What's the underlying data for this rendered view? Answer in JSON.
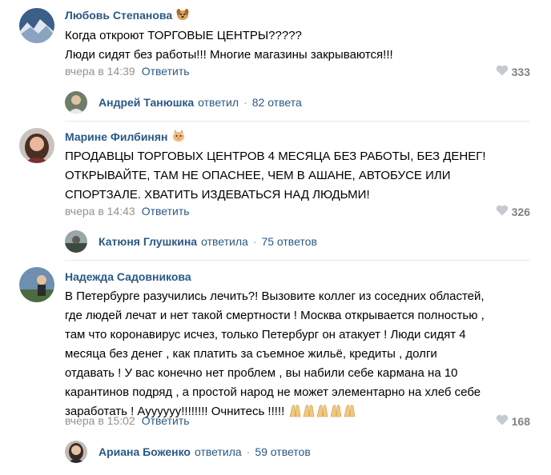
{
  "comments": [
    {
      "author": "Любовь Степанова",
      "badge_icon": "dog-icon",
      "text": "Когда откроют ТОРГОВЫЕ ЦЕНТРЫ?????\nЛюди сидят без работы!!! Многие магазины закрываются!!!",
      "time": "вчера в 14:39",
      "reply_label": "Ответить",
      "likes": "333",
      "thread": {
        "name": "Андрей Танюшка",
        "verb": "ответил",
        "count": "82 ответа"
      }
    },
    {
      "author": "Марине Филбинян",
      "badge_icon": "cat-icon",
      "text": "ПРОДАВЦЫ ТОРГОВЫХ ЦЕНТРОВ 4 МЕСЯЦА БЕЗ РАБОТЫ, БЕЗ ДЕНЕГ!\nОТКРЫВАЙТЕ, ТАМ НЕ ОПАСНЕЕ, ЧЕМ В АШАНЕ, АВТОБУСЕ ИЛИ\nСПОРТЗАЛЕ. ХВАТИТЬ ИЗДЕВАТЬСЯ НАД ЛЮДЬМИ!",
      "time": "вчера в 14:43",
      "reply_label": "Ответить",
      "likes": "326",
      "thread": {
        "name": "Катюня Глушкина",
        "verb": "ответила",
        "count": "75 ответов"
      }
    },
    {
      "author": "Надежда Садовникова",
      "text": "В Петербурге разучились лечить?! Вызовите коллег из соседних областей,\nгде людей лечат и нет такой смертности ! Москва открывается полностью ,\nтам что коронавирус исчез, только Петербург он атакует ! Люди сидят 4\nмесяца без денег , как платить за съемное жильё, кредиты , долги\nотдавать ! У вас конечно нет проблем , вы набили себе кармана на 10\nкарантинов подряд , а простой народ не может элементарно на хлеб себе\nзаработать ! Ауууууу!!!!!!!! Очнитесь !!!!!",
      "emoji_icon": "praying-hands-icon",
      "time": "вчера в 15:02",
      "reply_label": "Ответить",
      "likes": "168",
      "thread": {
        "name": "Ариана Боженко",
        "verb": "ответила",
        "count": "59 ответов"
      }
    }
  ],
  "colors": {
    "link": "#2a5885",
    "muted": "#939393",
    "divider": "#e7e8ec"
  }
}
